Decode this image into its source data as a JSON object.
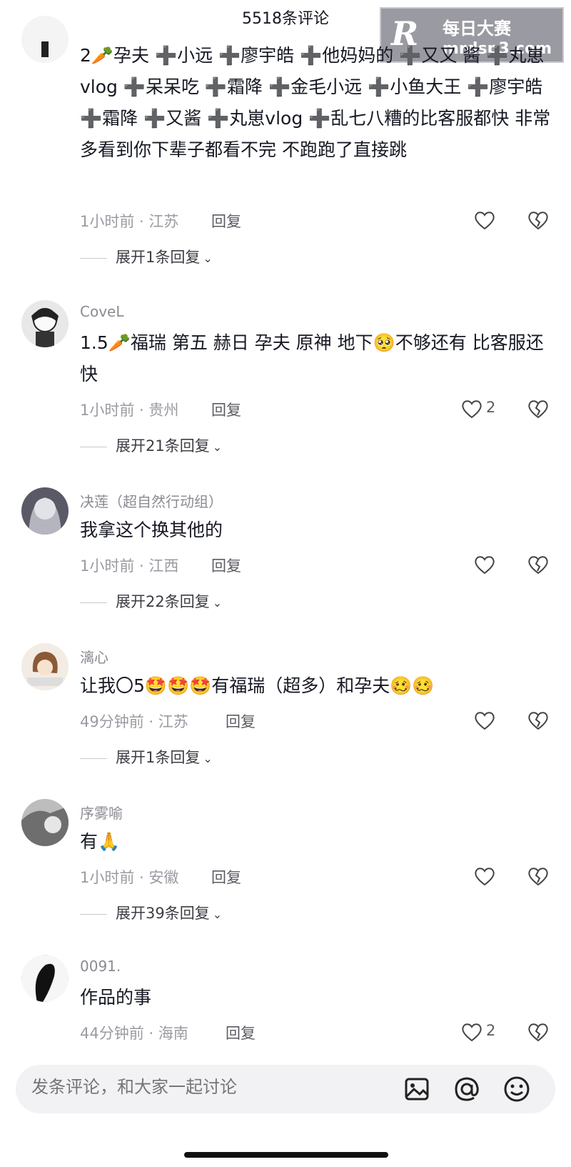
{
  "header": {
    "title": "5518条评论"
  },
  "watermark": {
    "logo": "R",
    "text_cn": "每日大赛",
    "url": "mrdsp3.com"
  },
  "comments": [
    {
      "user": "",
      "text": "2🥕孕夫 ➕小远 ➕廖宇皓 ➕他妈妈的 ➕又又 酱 ➕丸崽vlog ➕呆呆吃 ➕霜降 ➕金毛小远 ➕小鱼大王 ➕廖宇皓 ➕霜降 ➕又酱 ➕丸崽vlog ➕乱七八糟的比客服都快 非常多看到你下辈子都看不完 不跑跑了直接跳",
      "meta": "1小时前 · 江苏",
      "reply": "回复",
      "likes": "",
      "expand": "展开1条回复"
    },
    {
      "user": "CoveL",
      "text": "1.5🥕福瑞 第五 赫日 孕夫 原神 地下🥺不够还有 比客服还快",
      "meta": "1小时前 · 贵州",
      "reply": "回复",
      "likes": "2",
      "expand": "展开21条回复"
    },
    {
      "user": "决莲（超自然行动组）",
      "text": "我拿这个换其他的",
      "meta": "1小时前 · 江西",
      "reply": "回复",
      "likes": "",
      "expand": "展开22条回复"
    },
    {
      "user": "漓心",
      "text": "让我〇5🤩🤩🤩有福瑞（超多）和孕夫🥴🥴",
      "meta": "49分钟前 · 江苏",
      "reply": "回复",
      "likes": "",
      "expand": "展开1条回复"
    },
    {
      "user": "序雾喻",
      "text": "有🙏",
      "meta": "1小时前 · 安徽",
      "reply": "回复",
      "likes": "",
      "expand": "展开39条回复"
    },
    {
      "user": "0091.",
      "text": "作品的事",
      "meta": "44分钟前 · 海南",
      "reply": "回复",
      "likes": "2",
      "expand": ""
    }
  ],
  "composer": {
    "placeholder": "发条评论，和大家一起讨论"
  },
  "icons": {
    "like": "heart-outline-icon",
    "dislike": "broken-heart-icon",
    "image": "image-icon",
    "mention": "at-icon",
    "emoji": "smiley-icon"
  }
}
